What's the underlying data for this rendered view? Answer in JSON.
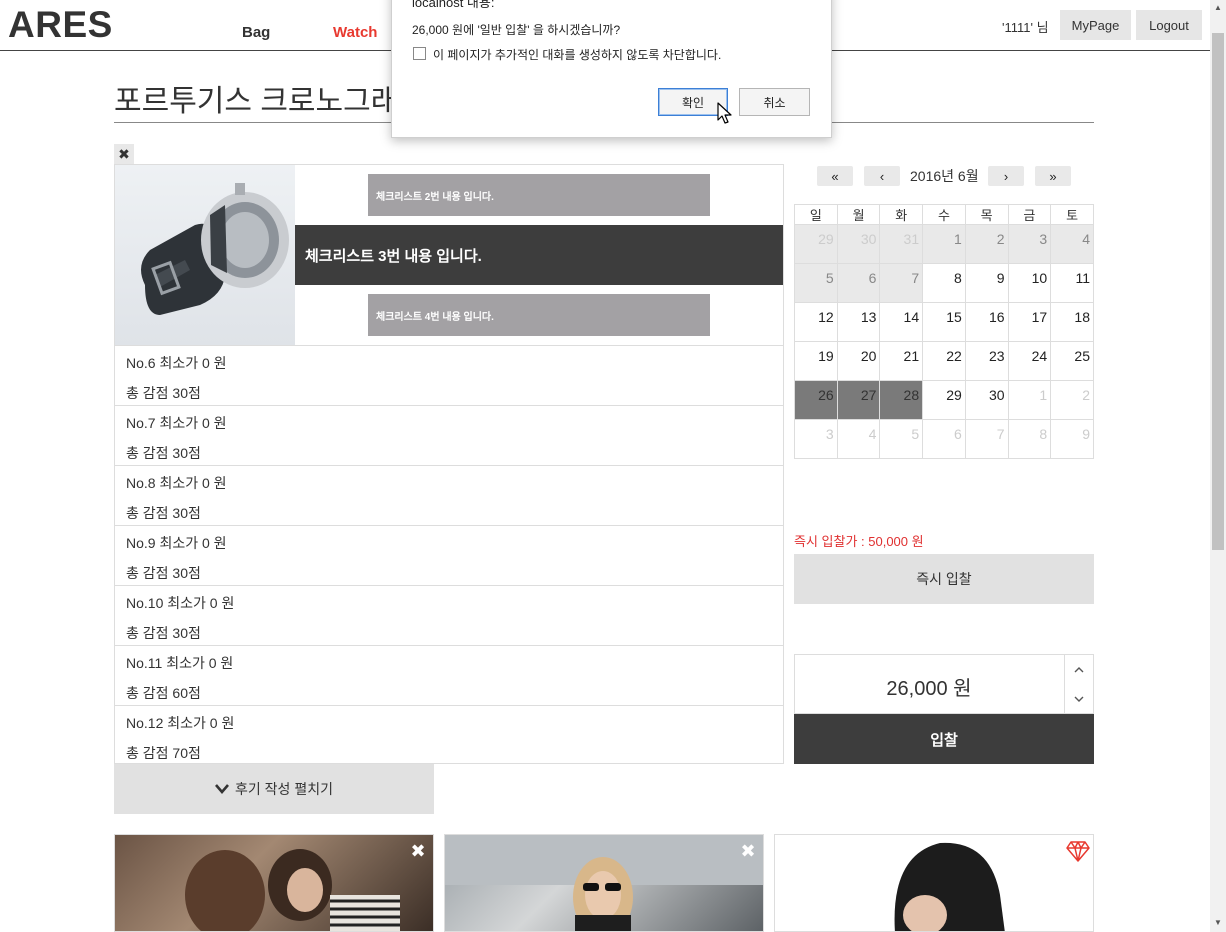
{
  "header": {
    "logo": "ARES",
    "nav": [
      "Bag",
      "Watch"
    ],
    "user_greeting": "'1111' 님",
    "mypage_label": "MyPage",
    "logout_label": "Logout"
  },
  "product": {
    "title": "포르투기스 크로노그래",
    "close_symbol": "✖",
    "checklist": {
      "item_2": "체크리스트 2번 내용 입니다.",
      "item_3": "체크리스트 3번 내용 입니다.",
      "item_4": "체크리스트 4번 내용 입니다."
    },
    "rows": [
      {
        "line1": "No.6 최소가 0 원",
        "line2": "총 감점 30점"
      },
      {
        "line1": "No.7 최소가 0 원",
        "line2": "총 감점 30점"
      },
      {
        "line1": "No.8 최소가 0 원",
        "line2": "총 감점 30점"
      },
      {
        "line1": "No.9 최소가 0 원",
        "line2": "총 감점 30점"
      },
      {
        "line1": "No.10 최소가 0 원",
        "line2": "총 감점 30점"
      },
      {
        "line1": "No.11 최소가 0 원",
        "line2": "총 감점 60점"
      },
      {
        "line1": "No.12 최소가 0 원",
        "line2": "총 감점 70점"
      }
    ],
    "review_toggle_label": "후기 작성 펼치기"
  },
  "calendar": {
    "title": "2016년 6월",
    "weekdays": [
      "일",
      "월",
      "화",
      "수",
      "목",
      "금",
      "토"
    ],
    "weeks": [
      [
        "29",
        "30",
        "31",
        "1",
        "2",
        "3",
        "4"
      ],
      [
        "5",
        "6",
        "7",
        "8",
        "9",
        "10",
        "11"
      ],
      [
        "12",
        "13",
        "14",
        "15",
        "16",
        "17",
        "18"
      ],
      [
        "19",
        "20",
        "21",
        "22",
        "23",
        "24",
        "25"
      ],
      [
        "26",
        "27",
        "28",
        "29",
        "30",
        "1",
        "2"
      ],
      [
        "3",
        "4",
        "5",
        "6",
        "7",
        "8",
        "9"
      ]
    ],
    "selected_days": [
      "26",
      "27",
      "28"
    ]
  },
  "bidding": {
    "instant_price_text": "즉시 입찰가 : 50,000 원",
    "instant_button_label": "즉시 입찰",
    "bid_amount": "26,000 원",
    "bid_button_label": "입찰"
  },
  "dialog": {
    "origin": "localhost 내용:",
    "message": "26,000 원에 '일반 입찰' 을 하시겠습니까?",
    "checkbox_label": "이 페이지가 추가적인 대화를 생성하지 않도록 차단합니다.",
    "ok_label": "확인",
    "cancel_label": "취소"
  },
  "icons": {
    "close": "close-icon",
    "chevron_down": "chevron-down-icon",
    "gem": "diamond-icon",
    "accent_color": "#e8392f"
  }
}
